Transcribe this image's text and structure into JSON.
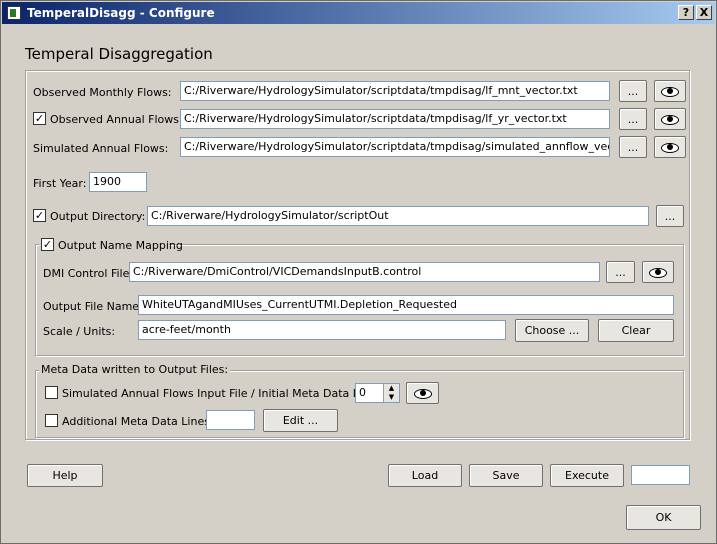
{
  "window": {
    "title": "TemperalDisagg - Configure",
    "help_glyph": "?",
    "close_glyph": "X"
  },
  "heading": "Temperal Disaggregation",
  "inputs": {
    "observed_monthly": {
      "label": "Observed Monthly Flows:",
      "value": "C:/Riverware/HydrologySimulator/scriptdata/tmpdisag/lf_mnt_vector.txt"
    },
    "observed_annual": {
      "label": "Observed Annual Flows:",
      "value": "C:/Riverware/HydrologySimulator/scriptdata/tmpdisag/lf_yr_vector.txt",
      "checked": true
    },
    "simulated_annual": {
      "label": "Simulated Annual Flows:",
      "value": "C:/Riverware/HydrologySimulator/scriptdata/tmpdisag/simulated_annflow_vector.txt"
    },
    "browse_label": "...",
    "view_icon": "eye-icon"
  },
  "first_year": {
    "label": "First Year:",
    "value": "1900"
  },
  "output_directory": {
    "label": "Output Directory:",
    "value": "C:/Riverware/HydrologySimulator/scriptOut",
    "checked": true
  },
  "name_mapping": {
    "label": "Output Name Mapping",
    "checked": true,
    "dmi_label": "DMI Control File:",
    "dmi_value": "C:/Riverware/DmiControl/VICDemandsInputB.control",
    "output_file_label": "Output File Name:",
    "output_file_value": "WhiteUTAgandMIUses_CurrentUTMI.Depletion_Requested",
    "scale_label": "Scale / Units:",
    "scale_value": "acre-feet/month",
    "choose_label": "Choose ...",
    "clear_label": "Clear"
  },
  "metadata": {
    "group_label": "Meta Data written to Output Files:",
    "sim_label": "Simulated Annual Flows Input File / Initial Meta Data Lines:",
    "sim_value": "0",
    "sim_checked": false,
    "additional_label": "Additional Meta Data Lines:",
    "additional_value": "",
    "additional_checked": false,
    "edit_label": "Edit ..."
  },
  "bottom": {
    "help": "Help",
    "load": "Load",
    "save": "Save",
    "execute": "Execute",
    "execute_status": "",
    "ok": "OK"
  },
  "check_glyph": "✓"
}
